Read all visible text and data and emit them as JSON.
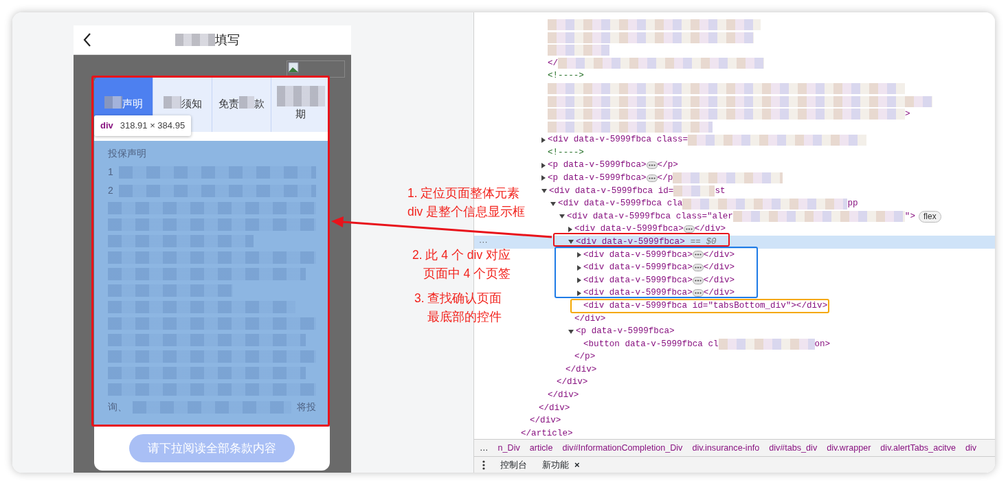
{
  "phone": {
    "title_segments": [
      {
        "kind": "blur"
      },
      {
        "kind": "text",
        "text": "填写"
      }
    ],
    "tabs": [
      {
        "segments": [
          {
            "kind": "blur"
          },
          {
            "kind": "text",
            "text": "声明"
          }
        ],
        "selected": true
      },
      {
        "segments": [
          {
            "kind": "blur"
          },
          {
            "kind": "text",
            "text": "须知"
          }
        ],
        "selected": false
      },
      {
        "segments": [
          {
            "kind": "text",
            "text": "免责"
          },
          {
            "kind": "blur"
          },
          {
            "kind": "text",
            "text": "款"
          }
        ],
        "selected": false
      },
      {
        "segments": [
          {
            "kind": "blur"
          },
          {
            "kind": "text",
            "text": "期"
          }
        ],
        "selected": false
      }
    ],
    "tooltip": {
      "tag": "div",
      "size": "318.91 × 384.95"
    },
    "content": {
      "heading": "投保声明",
      "numbers": [
        "1",
        "2"
      ],
      "tail_fragments": [
        "询、",
        "将投"
      ]
    },
    "button": {
      "label": "请下拉阅读全部条款内容",
      "disabled": true
    }
  },
  "annotations": [
    {
      "lines": [
        "1.  定位页面整体元素",
        "div 是整个信息显示框"
      ]
    },
    {
      "lines": [
        "2. 此 4 个 div 对应",
        "页面中 4 个页签"
      ]
    },
    {
      "lines": [
        "3.  查找确认页面",
        "最底部的控件"
      ]
    }
  ],
  "marks": [
    {
      "kind": "box",
      "color": "#e8131b"
    },
    {
      "kind": "arrow",
      "color": "#e8131b"
    },
    {
      "kind": "box",
      "color": "#e8131b"
    },
    {
      "kind": "box",
      "color": "#1e7be6"
    },
    {
      "kind": "box",
      "color": "#f5a800"
    }
  ],
  "dom_tree": [
    {
      "close": "</article>",
      "children": [
        {
          "close": "</div>",
          "children": [
            {
              "close": "</div>",
              "children": [
                {
                  "selected": false,
                  "parts": [
                    {
                      "kind": "blur"
                    }
                  ]
                },
                {
                  "selected": false,
                  "parts": [
                    {
                      "kind": "blur"
                    }
                  ]
                },
                {
                  "selected": false,
                  "parts": [
                    {
                      "kind": "blur"
                    }
                  ]
                },
                {
                  "selected": false,
                  "parts": [
                    {
                      "kind": "code",
                      "text": "</"
                    },
                    {
                      "kind": "blur"
                    }
                  ]
                },
                {
                  "selected": false,
                  "parts": [
                    {
                      "kind": "comment",
                      "text": "<!---->"
                    }
                  ]
                },
                {
                  "selected": false,
                  "parts": [
                    {
                      "kind": "blur"
                    }
                  ]
                },
                {
                  "selected": false,
                  "parts": [
                    {
                      "kind": "blur"
                    }
                  ]
                },
                {
                  "selected": false,
                  "parts": [
                    {
                      "kind": "blur"
                    },
                    {
                      "kind": "code",
                      "text": ">"
                    }
                  ]
                },
                {
                  "selected": false,
                  "parts": [
                    {
                      "kind": "blur"
                    }
                  ]
                },
                {
                  "selected": false,
                  "expanded": false,
                  "parts": [
                    {
                      "kind": "code",
                      "text": "<div data-v-5999fbca class="
                    },
                    {
                      "kind": "blur"
                    }
                  ]
                },
                {
                  "selected": false,
                  "parts": [
                    {
                      "kind": "comment",
                      "text": "<!---->"
                    }
                  ]
                },
                {
                  "selected": false,
                  "expanded": false,
                  "parts": [
                    {
                      "kind": "code",
                      "text": "<p data-v-5999fbca>"
                    },
                    {
                      "kind": "ellipsis"
                    },
                    {
                      "kind": "code",
                      "text": "</p>"
                    }
                  ]
                },
                {
                  "selected": false,
                  "expanded": false,
                  "parts": [
                    {
                      "kind": "code",
                      "text": "<p data-v-5999fbca>"
                    },
                    {
                      "kind": "ellipsis"
                    },
                    {
                      "kind": "code",
                      "text": "</p"
                    },
                    {
                      "kind": "blur"
                    }
                  ]
                },
                {
                  "selected": false,
                  "expanded": true,
                  "parts": [
                    {
                      "kind": "code",
                      "text": "<div data-v-5999fbca id="
                    },
                    {
                      "kind": "blur"
                    },
                    {
                      "kind": "code",
                      "text": "st"
                    }
                  ],
                  "close": "</div>",
                  "children": [
                    {
                      "selected": false,
                      "expanded": true,
                      "parts": [
                        {
                          "kind": "code",
                          "text": "<div data-v-5999fbca cla"
                        },
                        {
                          "kind": "blur"
                        },
                        {
                          "kind": "code",
                          "text": "pp"
                        }
                      ],
                      "close": "</div>",
                      "children": [
                        {
                          "selected": false,
                          "expanded": true,
                          "parts": [
                            {
                              "kind": "code",
                              "text": "<div data-v-5999fbca class=\"aler"
                            },
                            {
                              "kind": "blur"
                            },
                            {
                              "kind": "code",
                              "text": "\">"
                            },
                            {
                              "kind": "badge",
                              "text": "flex"
                            }
                          ],
                          "close": "</div>",
                          "children": [
                            {
                              "selected": false,
                              "expanded": false,
                              "parts": [
                                {
                                  "kind": "code",
                                  "text": "<div data-v-5999fbca>"
                                },
                                {
                                  "kind": "ellipsis"
                                },
                                {
                                  "kind": "code",
                                  "text": "</div>"
                                }
                              ]
                            },
                            {
                              "selected": true,
                              "gutter": "···",
                              "expanded": true,
                              "parts": [
                                {
                                  "kind": "code",
                                  "text": "<div data-v-5999fbca>"
                                },
                                {
                                  "kind": "note",
                                  "text": "== $0"
                                }
                              ],
                              "close": "</div>",
                              "children": [
                                {
                                  "selected": false,
                                  "expanded": false,
                                  "parts": [
                                    {
                                      "kind": "code",
                                      "text": "<div data-v-5999fbca>"
                                    },
                                    {
                                      "kind": "ellipsis"
                                    },
                                    {
                                      "kind": "code",
                                      "text": "</div>"
                                    }
                                  ]
                                },
                                {
                                  "selected": false,
                                  "expanded": false,
                                  "parts": [
                                    {
                                      "kind": "code",
                                      "text": "<div data-v-5999fbca>"
                                    },
                                    {
                                      "kind": "ellipsis"
                                    },
                                    {
                                      "kind": "code",
                                      "text": "</div>"
                                    }
                                  ]
                                },
                                {
                                  "selected": false,
                                  "expanded": false,
                                  "parts": [
                                    {
                                      "kind": "code",
                                      "text": "<div data-v-5999fbca>"
                                    },
                                    {
                                      "kind": "ellipsis"
                                    },
                                    {
                                      "kind": "code",
                                      "text": "</div>"
                                    }
                                  ]
                                },
                                {
                                  "selected": false,
                                  "expanded": false,
                                  "parts": [
                                    {
                                      "kind": "code",
                                      "text": "<div data-v-5999fbca>"
                                    },
                                    {
                                      "kind": "ellipsis"
                                    },
                                    {
                                      "kind": "code",
                                      "text": "</div>"
                                    }
                                  ]
                                },
                                {
                                  "selected": false,
                                  "parts": [
                                    {
                                      "kind": "code",
                                      "text": "<div data-v-5999fbca id=\"tabsBottom_div\"></div>"
                                    }
                                  ]
                                }
                              ]
                            },
                            {
                              "selected": false,
                              "expanded": true,
                              "parts": [
                                {
                                  "kind": "code",
                                  "text": "<p data-v-5999fbca>"
                                }
                              ],
                              "close": "</p>",
                              "children": [
                                {
                                  "selected": false,
                                  "parts": [
                                    {
                                      "kind": "code",
                                      "text": "<button data-v-5999fbca cl"
                                    },
                                    {
                                      "kind": "blur"
                                    },
                                    {
                                      "kind": "code",
                                      "text": "on>"
                                    }
                                  ]
                                }
                              ]
                            }
                          ]
                        }
                      ]
                    }
                  ]
                }
              ]
            }
          ]
        }
      ]
    }
  ],
  "breadcrumb": {
    "overflow": "…",
    "items": [
      "n_Div",
      "article",
      "div#InformationCompletion_Div",
      "div.insurance-info",
      "div#tabs_div",
      "div.wrapper",
      "div.alertTabs_acitve",
      "div"
    ]
  },
  "drawer": {
    "tabs": [
      {
        "label": "控制台"
      },
      {
        "label": "新功能",
        "close": "×"
      }
    ]
  }
}
